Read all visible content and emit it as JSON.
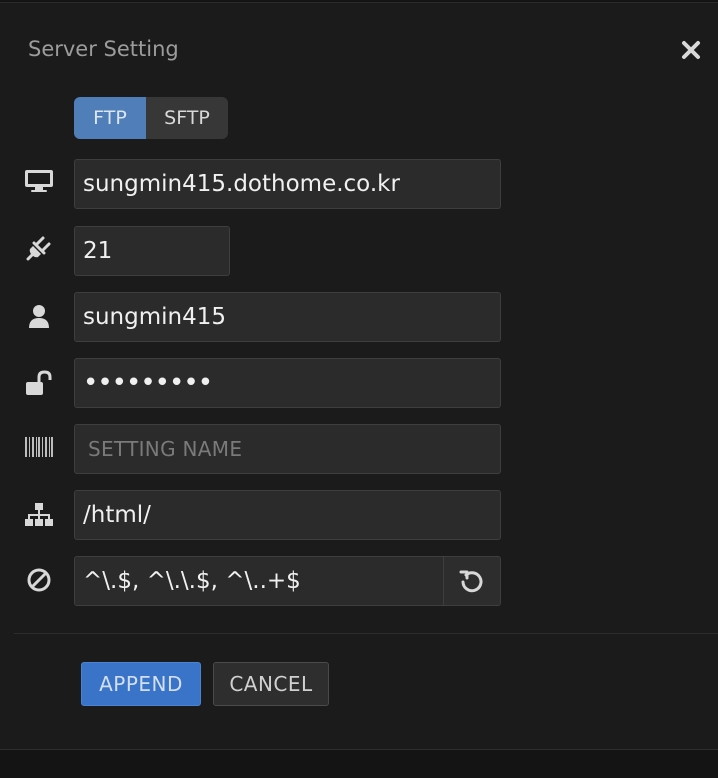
{
  "dialog": {
    "title": "Server Setting"
  },
  "protocol": {
    "options": [
      "FTP",
      "SFTP"
    ],
    "selected": "FTP"
  },
  "fields": {
    "host": {
      "value": "sungmin415.dothome.co.kr",
      "icon": "monitor-icon"
    },
    "port": {
      "value": "21",
      "icon": "plug-icon"
    },
    "username": {
      "value": "sungmin415",
      "icon": "user-icon"
    },
    "password": {
      "value": "•••••••••",
      "icon": "unlock-icon"
    },
    "setting_name": {
      "value": "",
      "placeholder": "SETTING NAME",
      "icon": "barcode-icon"
    },
    "remote_path": {
      "value": "/html/",
      "icon": "sitemap-icon"
    },
    "ignore": {
      "value": "^\\.$, ^\\.\\.$, ^\\..+$",
      "icon": "ban-icon"
    }
  },
  "buttons": {
    "append": "APPEND",
    "cancel": "CANCEL"
  },
  "colors": {
    "accent": "#3a74c8",
    "protocol_active": "#4f7eb8",
    "background": "#1b1b1b"
  }
}
